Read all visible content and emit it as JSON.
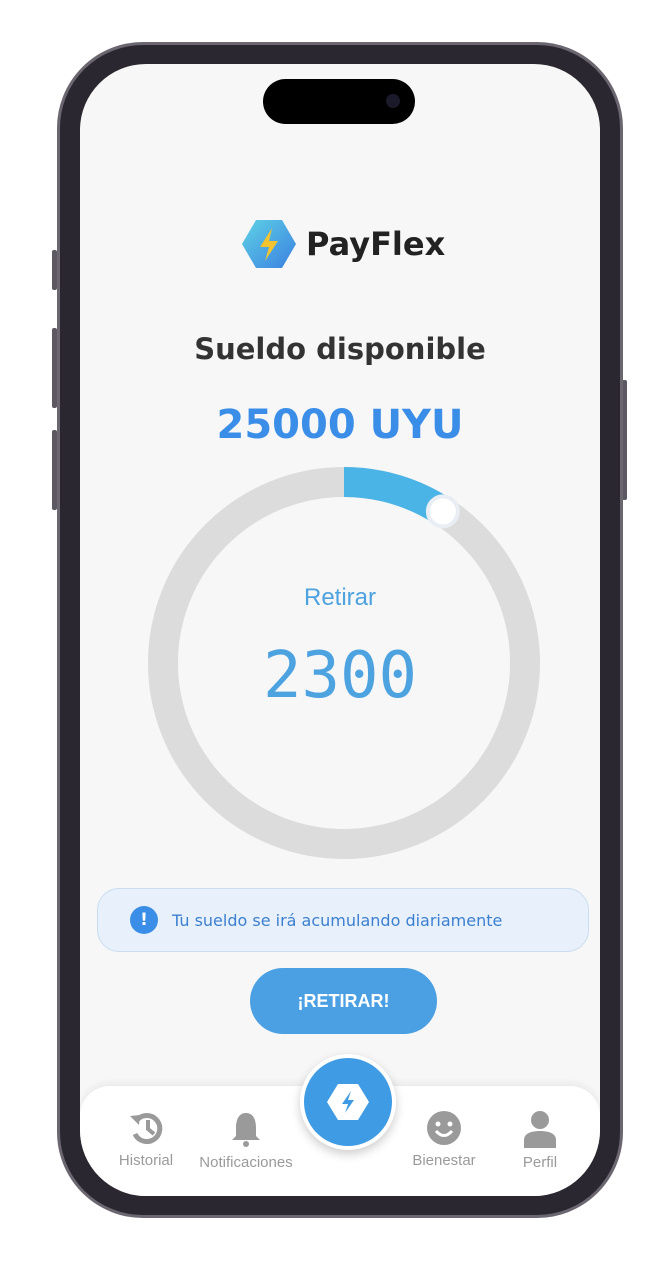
{
  "app": {
    "name": "PayFlex"
  },
  "main": {
    "title": "Sueldo disponible",
    "available_amount": "25000 UYU",
    "withdraw_label": "Retirar",
    "withdraw_value": "2300",
    "withdraw_fraction": 0.092,
    "info_text": "Tu sueldo se irá acumulando diariamente",
    "cta_label": "¡RETIRAR!"
  },
  "colors": {
    "accent": "#3b8ee8",
    "ring_track": "#dcdcdc",
    "ring_fill": "#4bb4e6"
  },
  "nav": {
    "items": [
      {
        "label": "Historial",
        "icon": "history-icon"
      },
      {
        "label": "Notificaciones",
        "icon": "bell-icon"
      },
      {
        "label": "Bienestar",
        "icon": "smiley-icon"
      },
      {
        "label": "Perfil",
        "icon": "user-icon"
      }
    ],
    "center_icon": "lightning-icon"
  }
}
